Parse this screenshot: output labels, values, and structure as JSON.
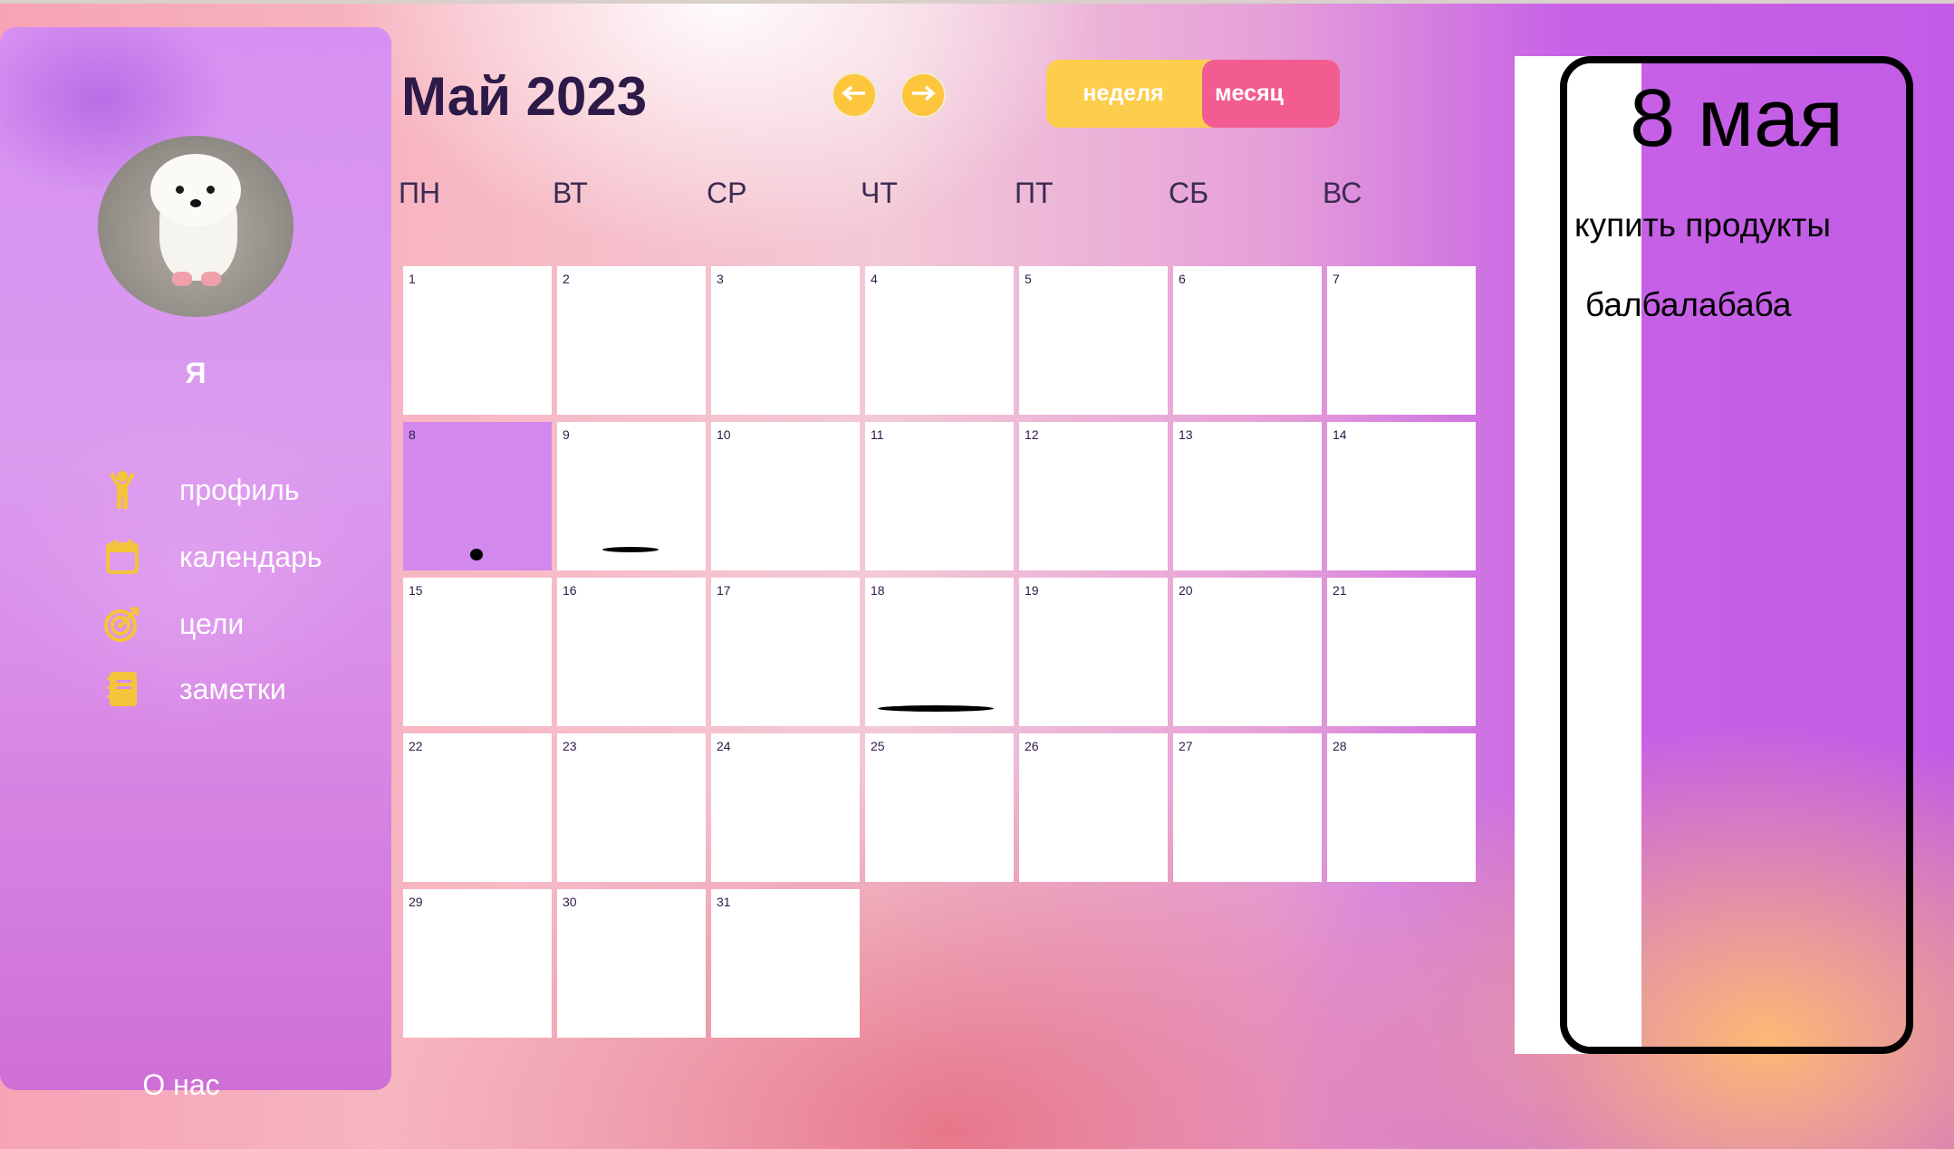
{
  "sidebar": {
    "user_name": "Я",
    "nav": [
      {
        "label": "профиль",
        "icon": "person-icon"
      },
      {
        "label": "календарь",
        "icon": "calendar-icon"
      },
      {
        "label": "цели",
        "icon": "target-icon"
      },
      {
        "label": "заметки",
        "icon": "notebook-icon"
      }
    ],
    "about": "О нас"
  },
  "calendar": {
    "title": "Май 2023",
    "view_toggle": {
      "week": "неделя",
      "month": "месяц",
      "active": "месяц"
    },
    "weekdays": [
      "ПН",
      "ВТ",
      "СР",
      "ЧТ",
      "ПТ",
      "СБ",
      "ВС"
    ],
    "days": [
      "1",
      "2",
      "3",
      "4",
      "5",
      "6",
      "7",
      "8",
      "9",
      "10",
      "11",
      "12",
      "13",
      "14",
      "15",
      "16",
      "17",
      "18",
      "19",
      "20",
      "21",
      "22",
      "23",
      "24",
      "25",
      "26",
      "27",
      "28",
      "29",
      "30",
      "31"
    ],
    "selected_day": "8"
  },
  "day_panel": {
    "date": "8 мая",
    "tasks": [
      "купить продукты",
      "балбалабаба"
    ]
  },
  "colors": {
    "accent_yellow": "#fdc63c",
    "accent_pink": "#f35c90",
    "selected_day": "#d288ec",
    "title": "#2e1a48"
  }
}
